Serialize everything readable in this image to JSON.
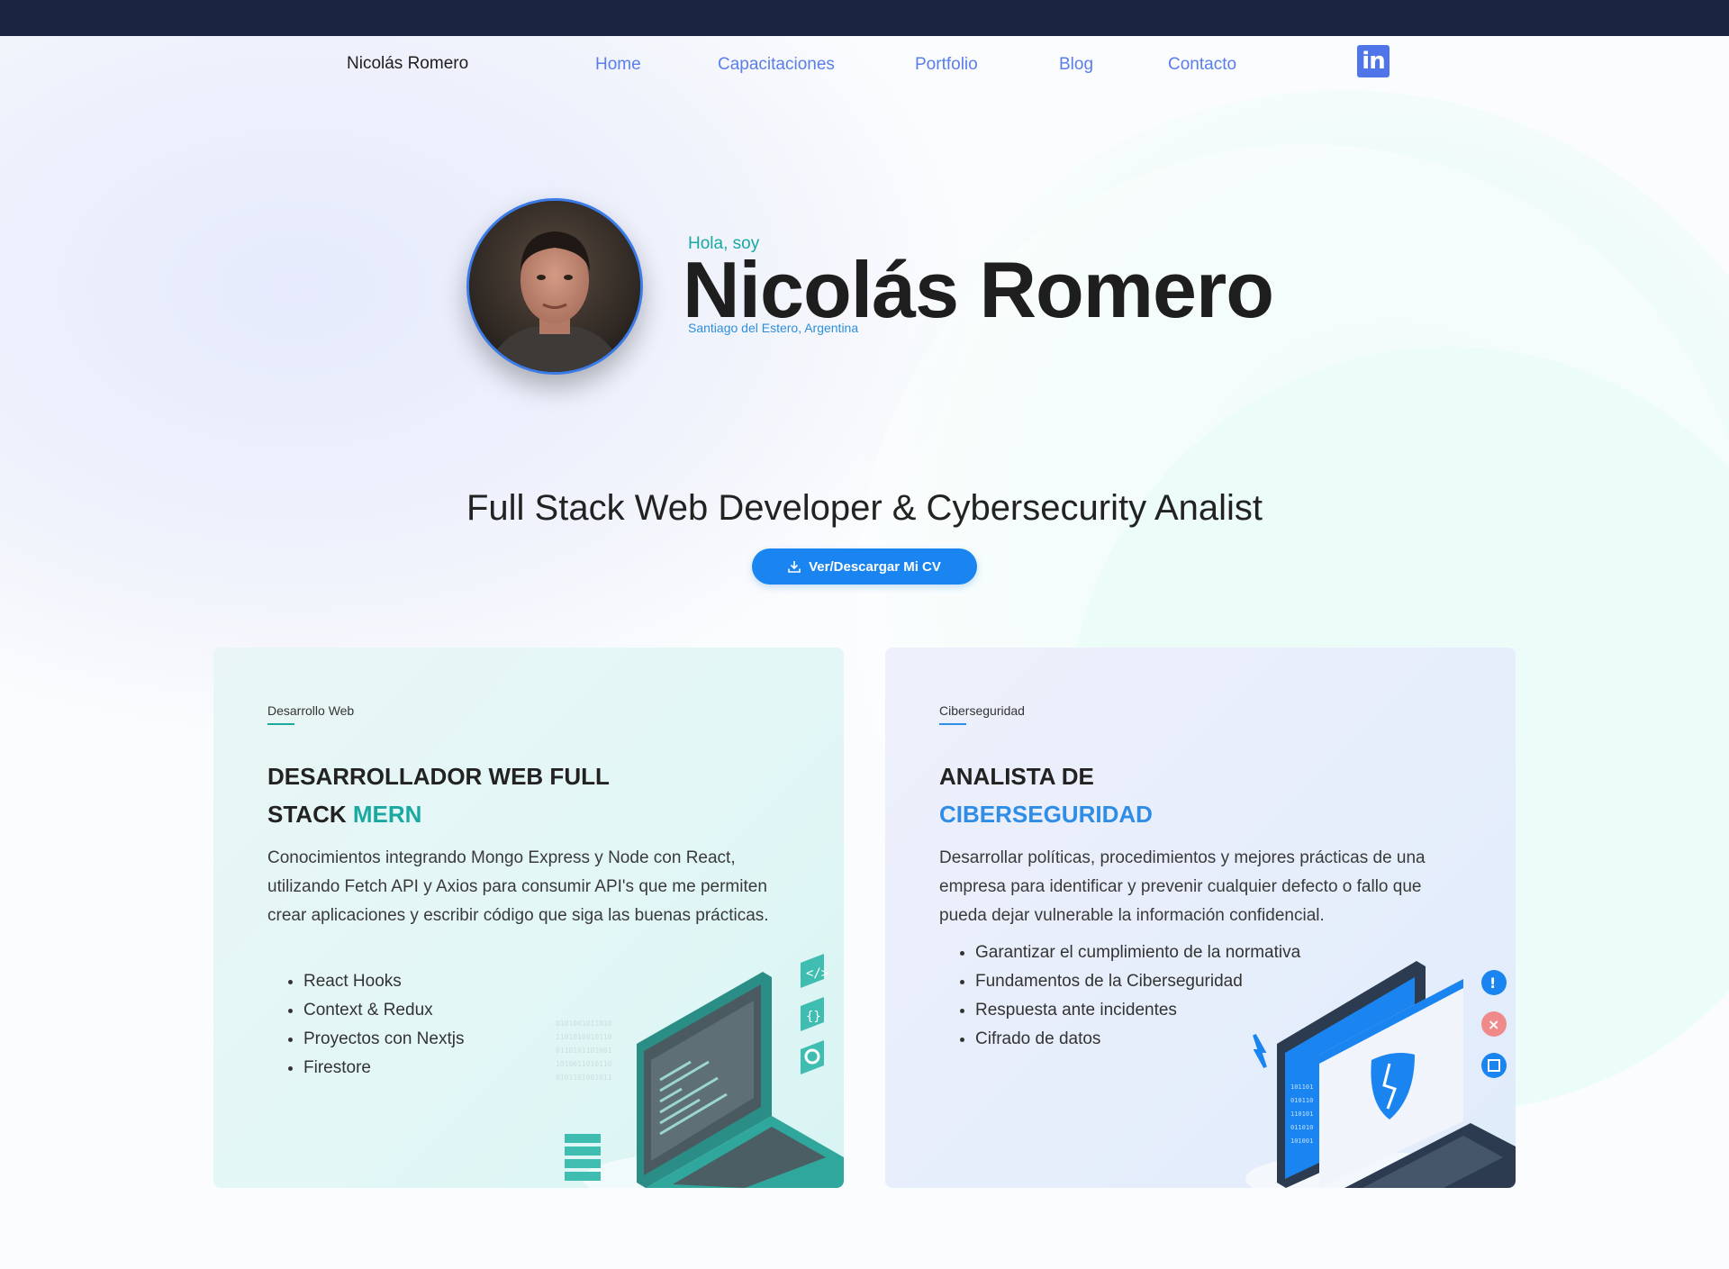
{
  "nav": {
    "brand": "Nicolás Romero",
    "links": [
      "Home",
      "Capacitaciones",
      "Portfolio",
      "Blog",
      "Contacto"
    ],
    "linkedin_icon": "linkedin-icon",
    "linkedin_text": "in",
    "link_color": "#5a7ee8"
  },
  "hero": {
    "greeting": "Hola, soy",
    "name": "Nicolás Romero",
    "location": "Santiago del Estero, Argentina",
    "subtitle": "Full Stack Web Developer & Cybersecurity Analist",
    "cv_button": "Ver/Descargar Mi CV",
    "cv_icon": "download-icon",
    "accent_teal": "#18a8a2",
    "accent_blue": "#1a84f0"
  },
  "cards": {
    "web": {
      "tag": "Desarrollo Web",
      "title_line1": "DESARROLLADOR WEB FULL",
      "title_line2_plain": "STACK ",
      "title_line2_accent": "MERN",
      "description": "Conocimientos integrando Mongo Express y Node con React, utilizando Fetch API y Axios para consumir API's que me permiten crear aplicaciones y escribir código que siga las buenas prácticas.",
      "items": [
        "React Hooks",
        "Context & Redux",
        "Proyectos con Nextjs",
        "Firestore"
      ],
      "illustration": "laptop-code-illustration"
    },
    "security": {
      "tag": "Ciberseguridad",
      "title_line1": "ANALISTA DE",
      "title_line2_accent": "CIBERSEGURIDAD",
      "description": "Desarrollar políticas, procedimientos y mejores prácticas de una empresa para identificar y prevenir cualquier defecto o fallo que pueda dejar vulnerable la información confidencial.",
      "items": [
        "Garantizar el cumplimiento de la normativa",
        "Fundamentos de la Ciberseguridad",
        "Respuesta ante incidentes",
        "Cifrado de datos"
      ],
      "illustration": "laptop-shield-illustration"
    }
  }
}
